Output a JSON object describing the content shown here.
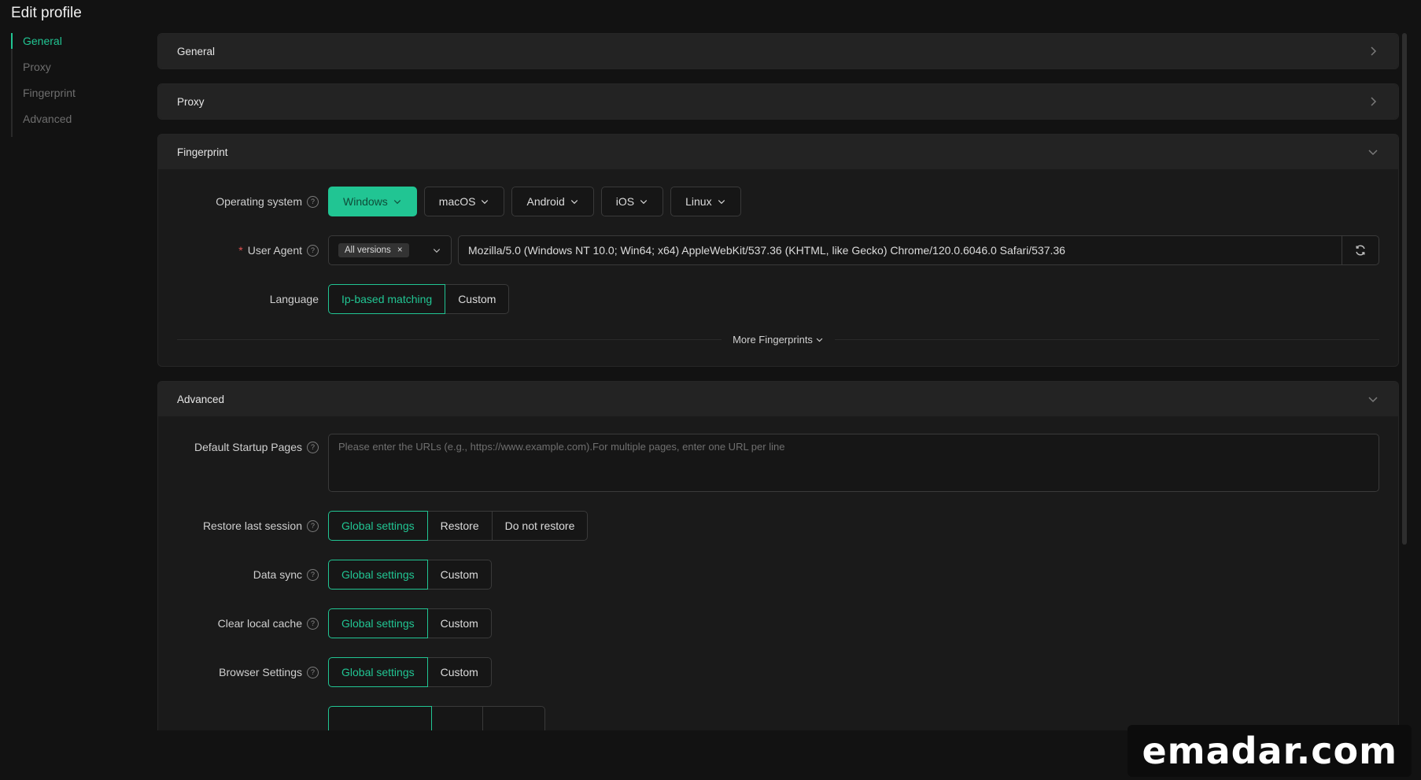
{
  "page_title": "Edit profile",
  "sidebar": {
    "items": [
      {
        "label": "General",
        "active": true
      },
      {
        "label": "Proxy",
        "active": false
      },
      {
        "label": "Fingerprint",
        "active": false
      },
      {
        "label": "Advanced",
        "active": false
      }
    ]
  },
  "sections": {
    "general": {
      "title": "General",
      "expanded": false
    },
    "proxy": {
      "title": "Proxy",
      "expanded": false
    },
    "fingerprint": {
      "title": "Fingerprint",
      "expanded": true,
      "os_label": "Operating system",
      "os_options": [
        "Windows",
        "macOS",
        "Android",
        "iOS",
        "Linux"
      ],
      "os_selected": "Windows",
      "ua_label": "User Agent",
      "ua_required": "*",
      "ua_version_tag": "All versions",
      "ua_value": "Mozilla/5.0 (Windows NT 10.0; Win64; x64) AppleWebKit/537.36 (KHTML, like Gecko) Chrome/120.0.6046.0 Safari/537.36",
      "language_label": "Language",
      "language_options": [
        "Ip-based matching",
        "Custom"
      ],
      "more_link": "More Fingerprints"
    },
    "advanced": {
      "title": "Advanced",
      "expanded": true,
      "startup_label": "Default Startup Pages",
      "startup_placeholder": "Please enter the URLs (e.g., https://www.example.com).For multiple pages, enter one URL per line",
      "restore_label": "Restore last session",
      "restore_options": [
        "Global settings",
        "Restore",
        "Do not restore"
      ],
      "datasync_label": "Data sync",
      "datasync_options": [
        "Global settings",
        "Custom"
      ],
      "cache_label": "Clear local cache",
      "cache_options": [
        "Global settings",
        "Custom"
      ],
      "browser_label": "Browser Settings",
      "browser_options": [
        "Global settings",
        "Custom"
      ]
    }
  },
  "watermark": "emadar.com",
  "colors": {
    "accent": "#21c593",
    "background": "#121212",
    "panel": "#1a1a1a",
    "header": "#232323"
  },
  "icons": {
    "help": "question-circle-icon",
    "chevron": "chevron-icon",
    "refresh": "refresh-icon",
    "clear": "close-icon"
  }
}
